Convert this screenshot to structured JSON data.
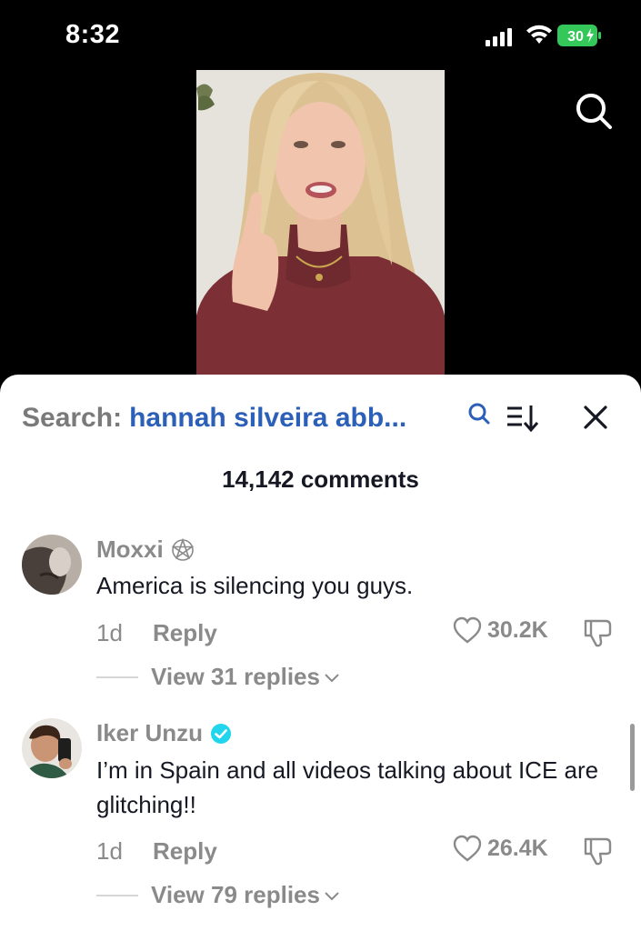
{
  "status": {
    "time": "8:32",
    "battery": "30"
  },
  "panel": {
    "search_prefix": "Search:",
    "search_term": "hannah silveira abb",
    "search_ellipsis": "...",
    "comment_count": "14,142 comments"
  },
  "comments": [
    {
      "author": "Moxxi",
      "author_badge": "pentagram-icon",
      "text": "America is silencing you guys.",
      "age": "1d",
      "reply_label": "Reply",
      "likes": "30.2K",
      "view_replies": "View 31 replies"
    },
    {
      "author": "Iker Unzu",
      "author_badge": "verified-badge-icon",
      "text": "I’m in Spain and all videos talking about ICE are glitching!!",
      "age": "1d",
      "reply_label": "Reply",
      "likes": "26.4K",
      "view_replies": "View 79 replies"
    }
  ],
  "colors": {
    "search_term": "#2b5fb8",
    "muted": "#8a8a8a",
    "text": "#161823",
    "verified": "#20d5ec",
    "battery": "#34c759"
  }
}
